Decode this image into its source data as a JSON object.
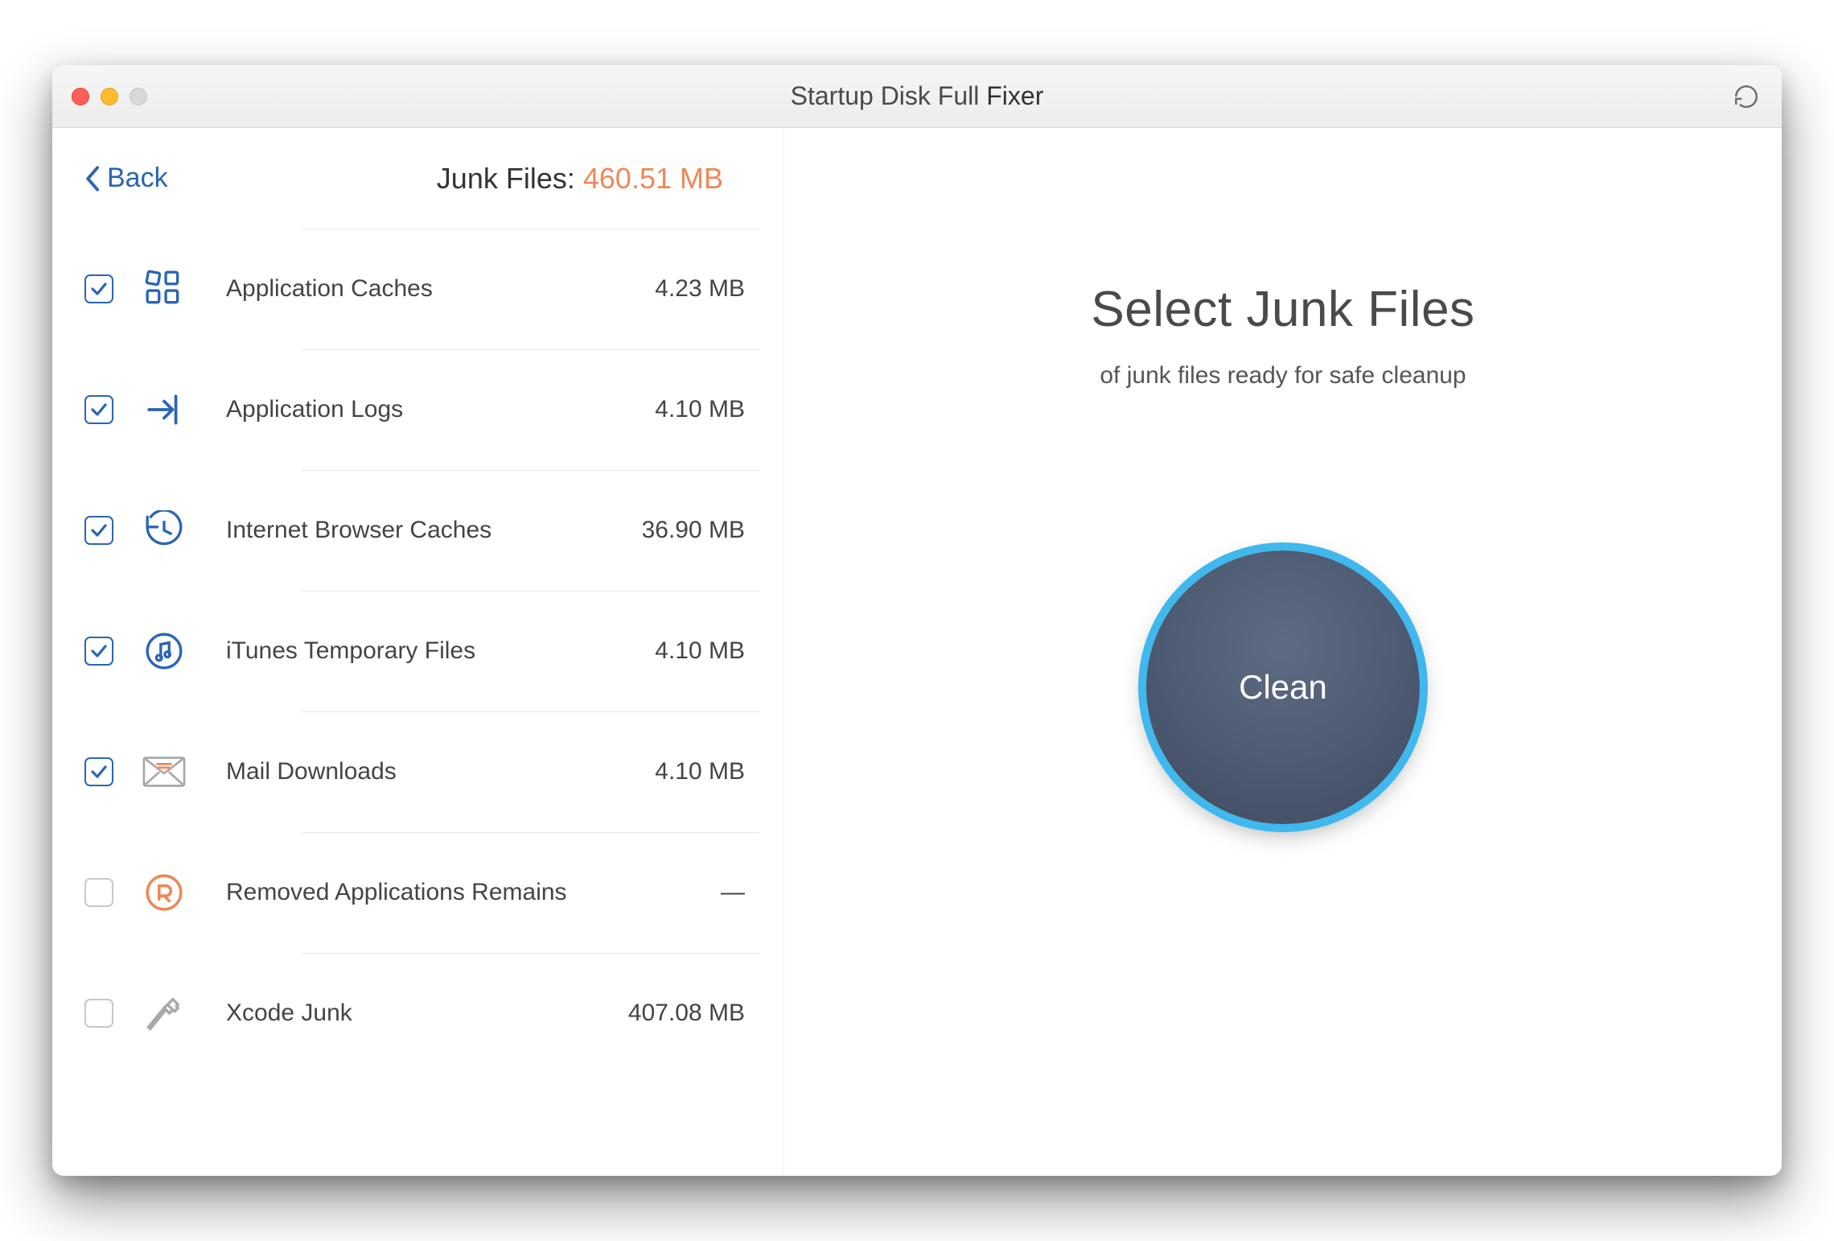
{
  "window": {
    "title_prefix": "Startup Disk Full",
    "title_bold": "Fixer"
  },
  "back_label": "Back",
  "junk_header": {
    "label": "Junk Files:",
    "amount": "460.51 MB"
  },
  "items": [
    {
      "label": "Application Caches",
      "size": "4.23 MB",
      "checked": true,
      "icon": "grid"
    },
    {
      "label": "Application Logs",
      "size": "4.10 MB",
      "checked": true,
      "icon": "arrow"
    },
    {
      "label": "Internet Browser Caches",
      "size": "36.90 MB",
      "checked": true,
      "icon": "clock"
    },
    {
      "label": "iTunes Temporary Files",
      "size": "4.10 MB",
      "checked": true,
      "icon": "music"
    },
    {
      "label": "Mail Downloads",
      "size": "4.10 MB",
      "checked": true,
      "icon": "mail"
    },
    {
      "label": "Removed Applications Remains",
      "size": "—",
      "checked": false,
      "icon": "removed"
    },
    {
      "label": "Xcode Junk",
      "size": "407.08 MB",
      "checked": false,
      "icon": "hammer"
    }
  ],
  "right": {
    "title": "Select Junk Files",
    "subtitle": "of junk files ready for safe cleanup",
    "clean_label": "Clean"
  },
  "colors": {
    "accent_blue": "#2a65b3",
    "accent_orange": "#ee8857"
  }
}
